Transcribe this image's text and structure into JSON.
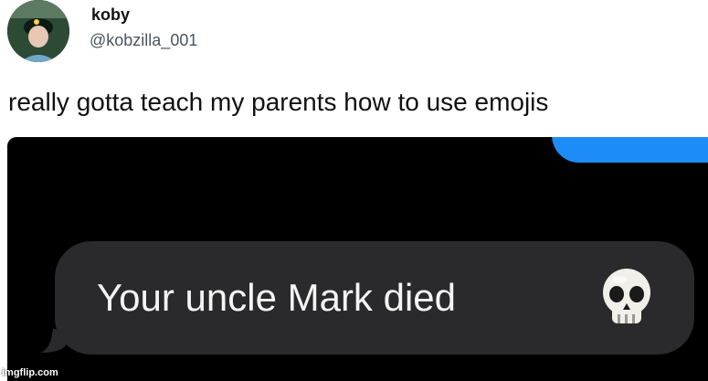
{
  "tweet": {
    "author_name": "koby",
    "author_handle": "@kobzilla_001",
    "text": "really gotta teach my parents how to use emojis"
  },
  "message": {
    "text": "Your uncle Mark died",
    "emoji_icon": "skull-icon"
  },
  "watermark": "imgflip.com",
  "colors": {
    "background": "#ffffff",
    "screenshot_bg": "#000000",
    "incoming_bubble": "#2a2a2c",
    "outgoing_bubble": "#1d8cf8"
  }
}
